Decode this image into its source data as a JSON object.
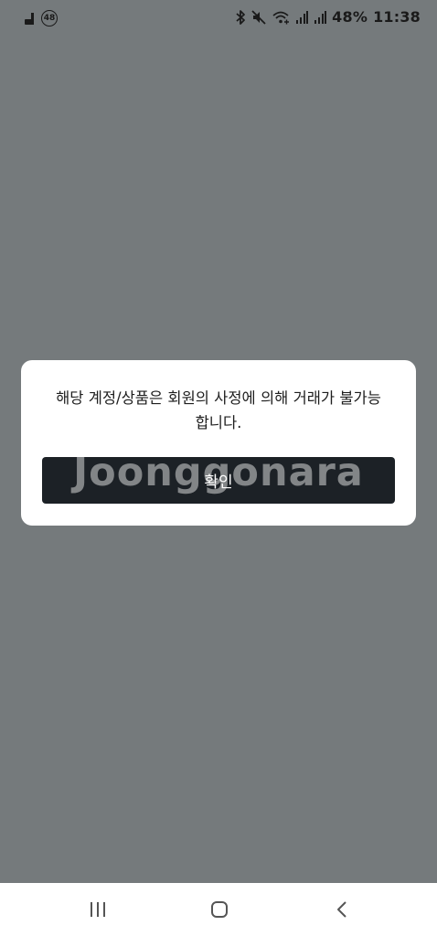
{
  "status_bar": {
    "badge": "48",
    "battery": "48%",
    "time": "11:38"
  },
  "dialog": {
    "message_line1": "해당 계정/상품은 회원의 사정에 의해 거래가 불가능",
    "message_line2": "합니다.",
    "confirm_label": "확인"
  },
  "watermark": "Joonggonara",
  "icons": {
    "status_left": [
      "app-notification-icon",
      "badge-48-icon"
    ],
    "status_right": [
      "bluetooth-icon",
      "mute-icon",
      "wifi-icon",
      "signal-icon",
      "signal-icon"
    ],
    "nav": [
      "recent-apps-icon",
      "home-icon",
      "back-icon"
    ]
  },
  "colors": {
    "scrim": "#757a7c",
    "dialog_bg": "#ffffff",
    "button_bg": "#1c2126",
    "button_text": "#ffffff"
  }
}
